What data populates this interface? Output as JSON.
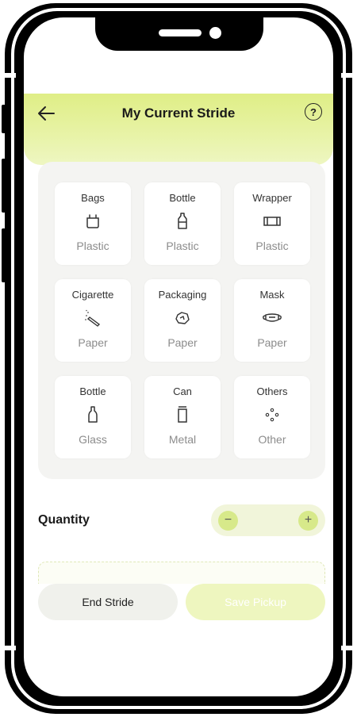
{
  "header": {
    "title": "My Current Stride",
    "back_icon": "arrow-left-icon",
    "help_label": "?"
  },
  "items": [
    {
      "name": "Bags",
      "icon": "bag-icon",
      "category": "Plastic"
    },
    {
      "name": "Bottle",
      "icon": "bottle-icon",
      "category": "Plastic"
    },
    {
      "name": "Wrapper",
      "icon": "wrapper-icon",
      "category": "Plastic"
    },
    {
      "name": "Cigarette",
      "icon": "cigarette-icon",
      "category": "Paper"
    },
    {
      "name": "Packaging",
      "icon": "packaging-icon",
      "category": "Paper"
    },
    {
      "name": "Mask",
      "icon": "mask-icon",
      "category": "Paper"
    },
    {
      "name": "Bottle",
      "icon": "glass-bottle-icon",
      "category": "Glass"
    },
    {
      "name": "Can",
      "icon": "can-icon",
      "category": "Metal"
    },
    {
      "name": "Others",
      "icon": "others-icon",
      "category": "Other"
    }
  ],
  "quantity": {
    "label": "Quantity",
    "minus": "−",
    "plus": "+"
  },
  "actions": {
    "end_label": "End Stride",
    "save_label": "Save Pickup"
  },
  "colors": {
    "accent": "#dfee86",
    "accent_button": "#d7e98a"
  }
}
